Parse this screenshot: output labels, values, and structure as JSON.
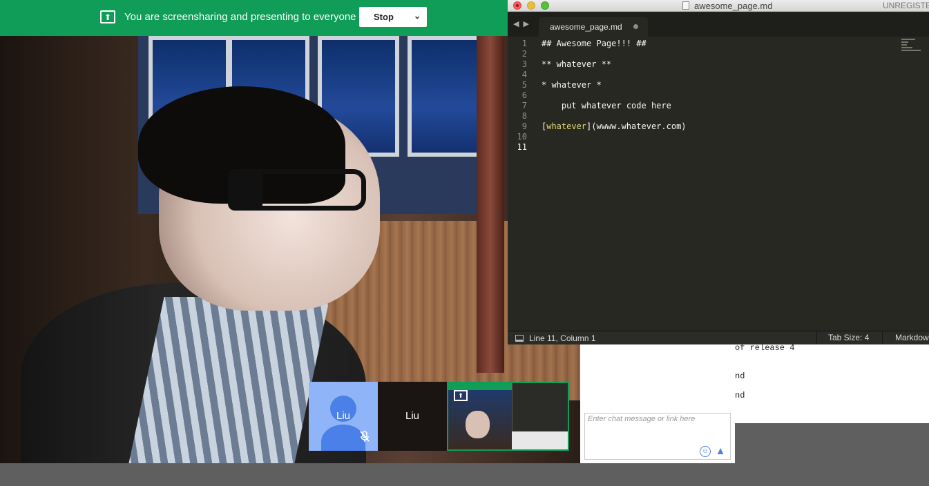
{
  "banner": {
    "message": "You are screensharing and presenting to everyone",
    "stop_label": "Stop",
    "color": "#0f9d58"
  },
  "participants": [
    {
      "name": "Liu",
      "muted": true,
      "avatar": "default-avatar"
    },
    {
      "name": "Liu"
    },
    {
      "name": "",
      "type": "screen-share-preview"
    }
  ],
  "chat": {
    "placeholder": "Enter chat message or link here"
  },
  "background_doc": {
    "lines": [
      "of release 4",
      "nd",
      "nd"
    ]
  },
  "editor": {
    "window_title": "awesome_page.md",
    "unregistered_label": "UNREGISTE",
    "tab_label": "awesome_page.md",
    "lines": [
      {
        "n": "1",
        "text": "## Awesome Page!!! ##"
      },
      {
        "n": "2",
        "text": ""
      },
      {
        "n": "3",
        "text": "** whatever **"
      },
      {
        "n": "4",
        "text": ""
      },
      {
        "n": "5",
        "text": "* whatever *"
      },
      {
        "n": "6",
        "text": ""
      },
      {
        "n": "7",
        "text": "    put whatever code here"
      },
      {
        "n": "8",
        "text": ""
      },
      {
        "n": "9",
        "link_open": "[",
        "link_text": "whatever",
        "link_rest": "](wwww.whatever.com)"
      },
      {
        "n": "10",
        "text": ""
      },
      {
        "n": "11",
        "text": ""
      }
    ],
    "status": {
      "position": "Line 11, Column 1",
      "tab_size": "Tab Size: 4",
      "syntax": "Markdown"
    },
    "theme_link_color": "#e6db74"
  }
}
